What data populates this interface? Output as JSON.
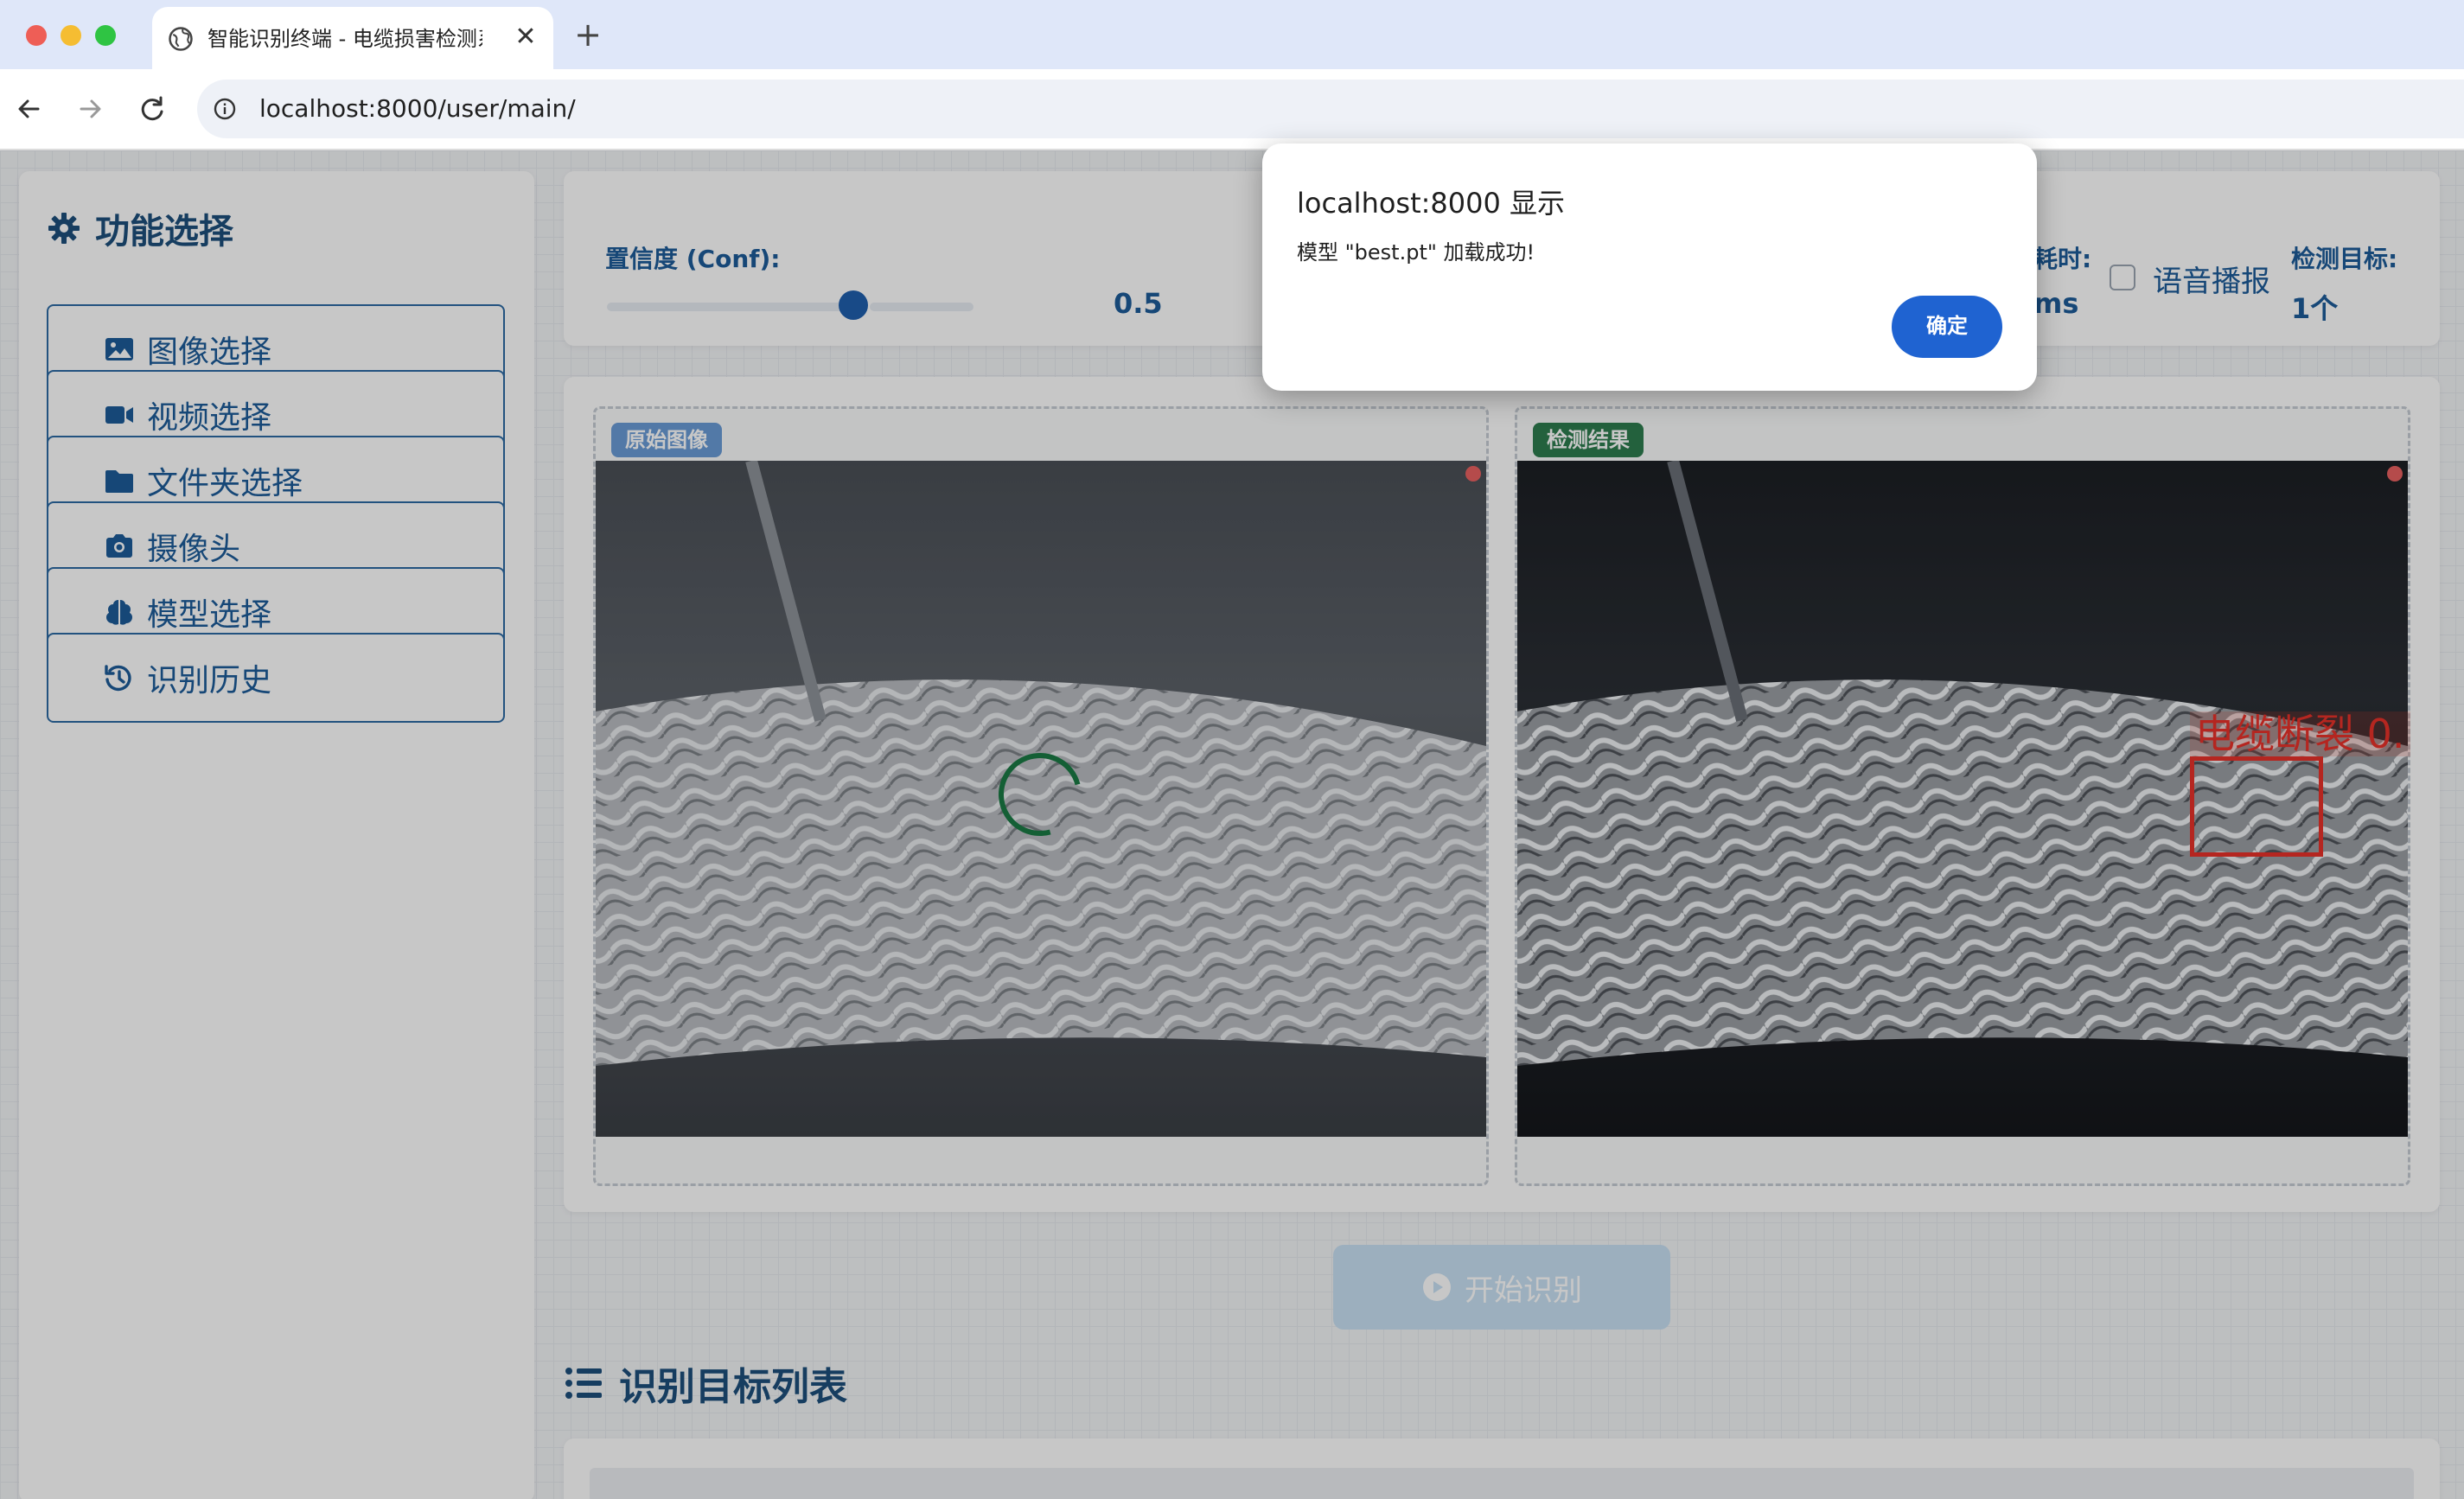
{
  "browser": {
    "tab_title": "智能识别终端 - 电缆损害检测系",
    "tab_close": "✕",
    "new_tab": "+",
    "url": "localhost:8000/user/main/"
  },
  "sidebar": {
    "title": "功能选择",
    "items": [
      {
        "label": "图像选择",
        "icon": "image-icon"
      },
      {
        "label": "视频选择",
        "icon": "video-icon"
      },
      {
        "label": "文件夹选择",
        "icon": "folder-icon"
      },
      {
        "label": "摄像头",
        "icon": "camera-icon"
      },
      {
        "label": "模型选择",
        "icon": "brain-icon"
      },
      {
        "label": "识别历史",
        "icon": "history-icon"
      }
    ]
  },
  "controls": {
    "conf_label": "置信度 (Conf):",
    "conf_value": "0.5",
    "conf_slider_fraction": 0.5,
    "time_label": "耗时:",
    "time_value": "ms",
    "voice_label": "语音播报",
    "voice_checked": false,
    "target_label": "检测目标:",
    "target_value": "1个"
  },
  "images": {
    "original_badge": "原始图像",
    "result_badge": "检测结果",
    "detection_label": "电缆断裂  0.",
    "detection_color": "#e8312a"
  },
  "start_button": {
    "label": "开始识别"
  },
  "list": {
    "title": "识别目标列表"
  },
  "dialog": {
    "title": "localhost:8000 显示",
    "message": "模型 \"best.pt\" 加载成功!",
    "ok_label": "确定"
  },
  "colors": {
    "primary": "#1d5c99",
    "dialog_button": "#1f63d1",
    "result_badge": "#2e7d4f"
  }
}
